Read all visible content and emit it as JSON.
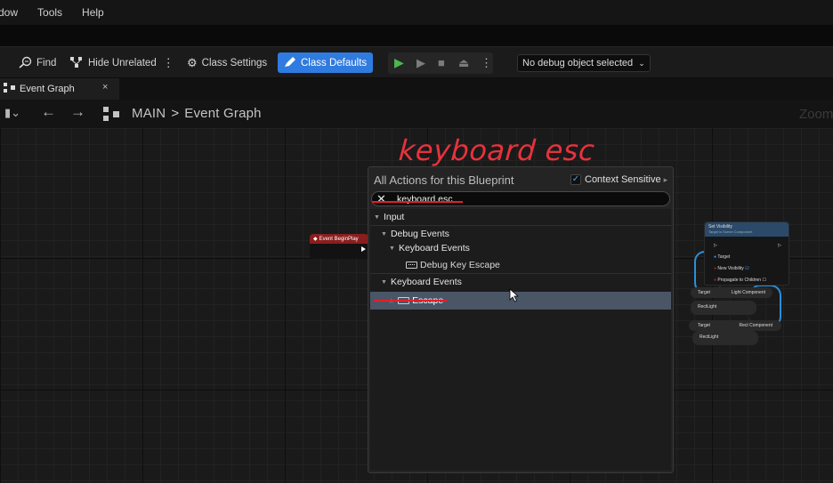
{
  "menubar": {
    "items": [
      "dow",
      "Tools",
      "Help"
    ]
  },
  "toolbar": {
    "find_label": "Find",
    "hide_unrelated_label": "Hide Unrelated",
    "class_settings_label": "Class Settings",
    "class_defaults_label": "Class Defaults",
    "debug_object_label": "No debug object selected"
  },
  "tab": {
    "label": "Event Graph",
    "close": "×"
  },
  "breadcrumb": {
    "root": "MAIN",
    "separator": ">",
    "current": "Event Graph",
    "zoom": "Zoom"
  },
  "annotation": {
    "text": "keyboard esc",
    "color": "#e2202a"
  },
  "graph": {
    "event_node": {
      "label": "Event BeginPlay"
    },
    "set_visibility_node": {
      "title": "Set Visibility",
      "subtitle": "Target is Scene Component",
      "pins": [
        "Target",
        "New Visibility",
        "Propagate to Children"
      ]
    },
    "get_node_1": {
      "target": "Target",
      "component": "Light Component"
    },
    "var_node_1": {
      "label": "RectLight"
    },
    "get_node_2": {
      "target": "Target",
      "component": "Rect Component"
    },
    "var_node_2": {
      "label": "RectLight"
    }
  },
  "action_menu": {
    "title": "All Actions for this Blueprint",
    "context_sensitive_label": "Context Sensitive",
    "context_sensitive_checked": true,
    "search": {
      "value": "keyboard esc",
      "clear_icon": "close-icon"
    },
    "tree": [
      {
        "label": "Input",
        "level": 0,
        "type": "category"
      },
      {
        "label": "Debug Events",
        "level": 1,
        "type": "category"
      },
      {
        "label": "Keyboard Events",
        "level": 2,
        "type": "category"
      },
      {
        "label": "Debug Key Escape",
        "level": 3,
        "type": "action"
      },
      {
        "label": "Keyboard Events",
        "level": 1,
        "type": "category"
      },
      {
        "label": "Escape",
        "level": 2,
        "type": "action",
        "selected": true
      }
    ]
  },
  "colors": {
    "accent_blue": "#2f7be0",
    "event_red": "#8a1e1e",
    "wire_blue": "#2e8fd8"
  }
}
